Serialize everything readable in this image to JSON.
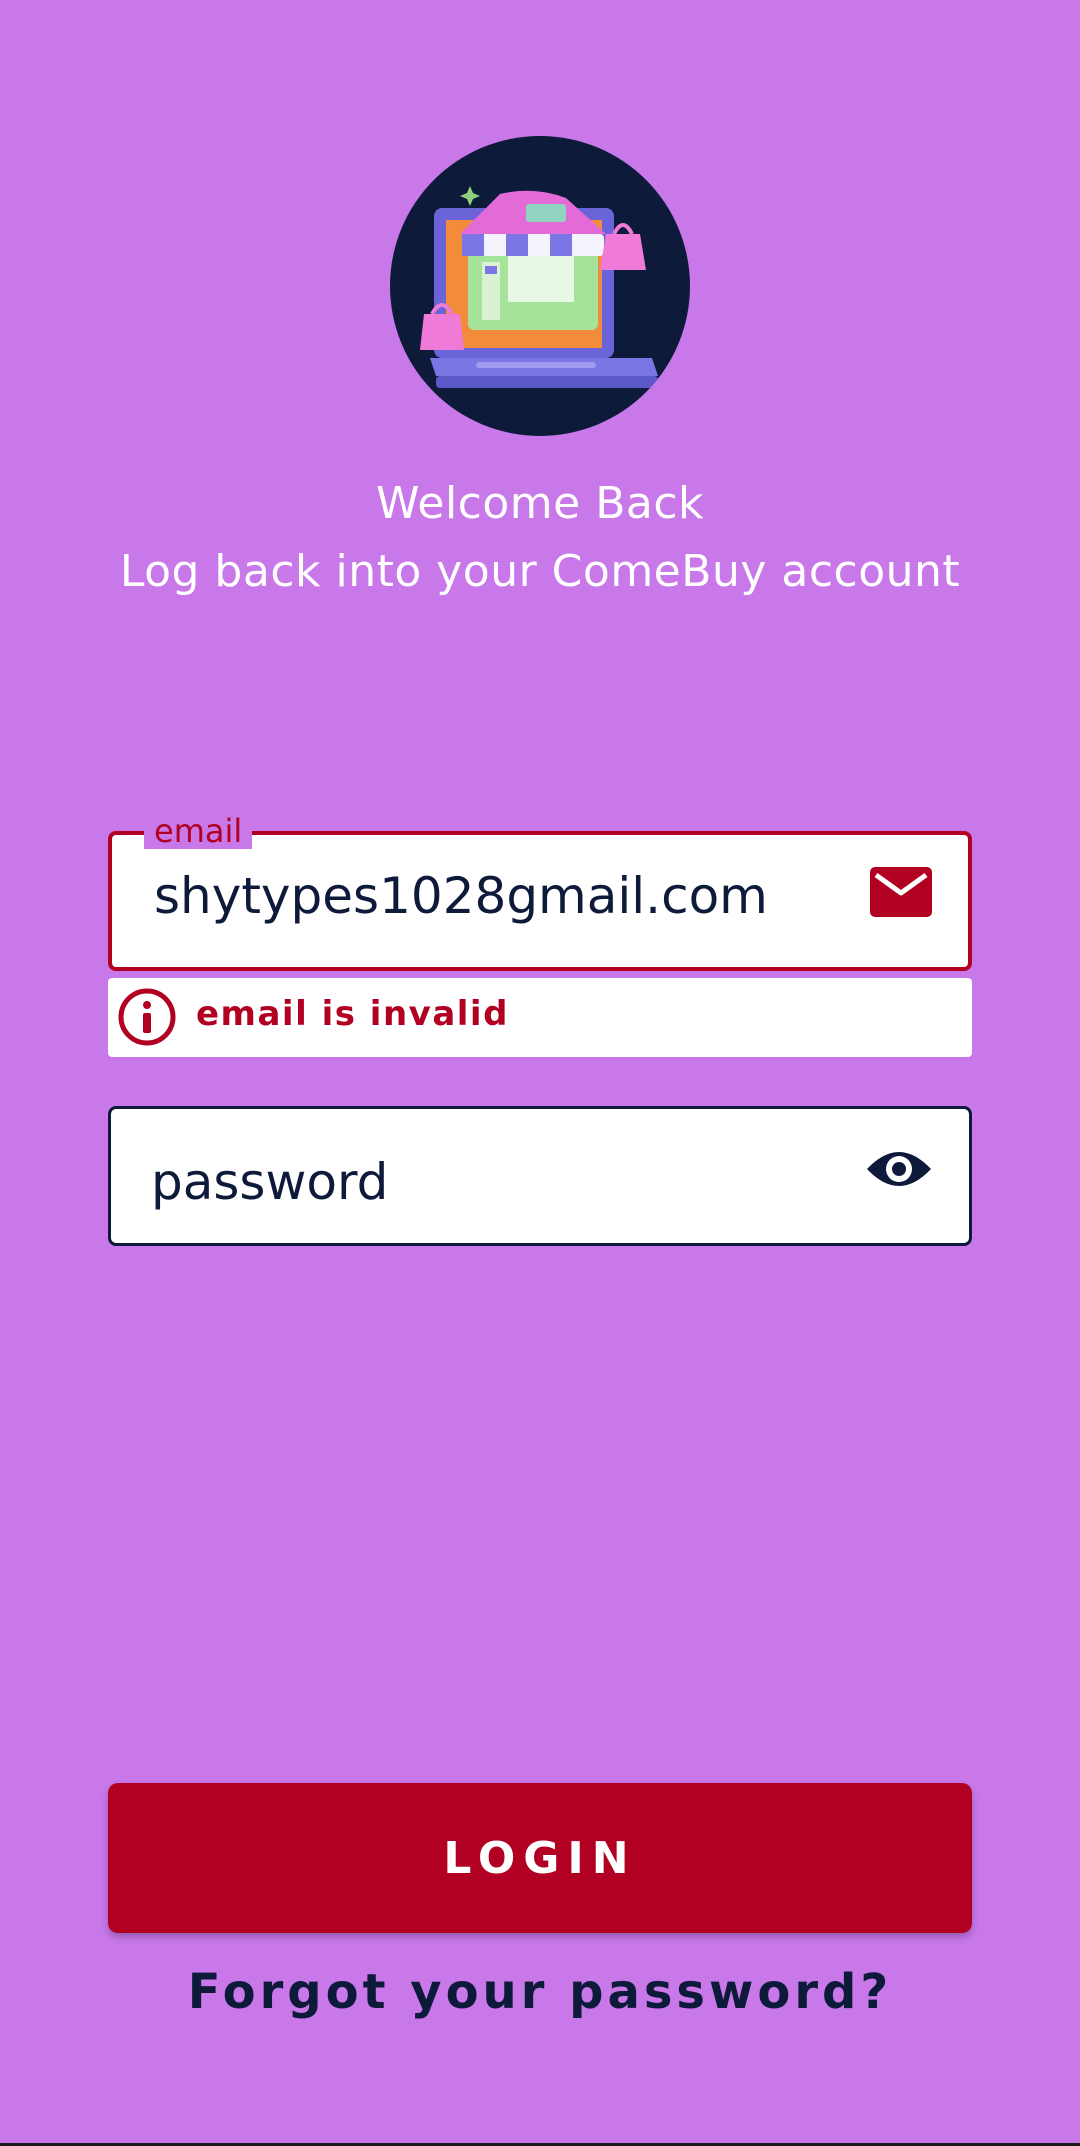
{
  "welcome": {
    "title": "Welcome Back",
    "subtitle": "Log back into your ComeBuy account"
  },
  "email": {
    "label": "email",
    "value": "shytypes1028gmail.com",
    "icon": "mail-icon",
    "error": "email is invalid",
    "error_icon": "info-circle-icon"
  },
  "password": {
    "placeholder": "password",
    "icon": "eye-icon"
  },
  "login": {
    "label": "LOGIN"
  },
  "forgot": {
    "label": "Forgot your password?"
  },
  "colors": {
    "background": "#c978ea",
    "accent": "#b10021",
    "text_dark": "#0e1a3a",
    "white": "#ffffff"
  }
}
